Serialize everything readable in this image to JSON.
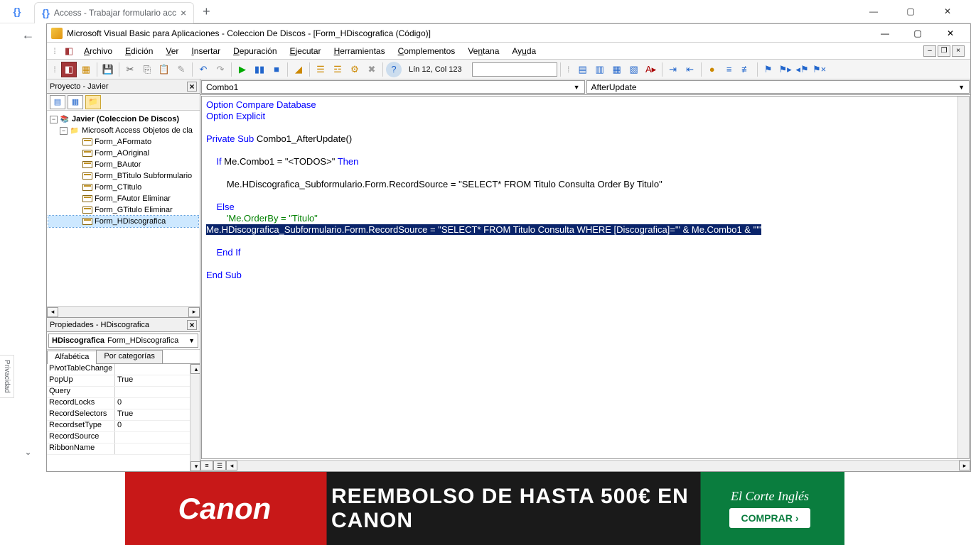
{
  "browser": {
    "tab_title": "Access - Trabajar formulario acc",
    "new_tab": "+"
  },
  "vba": {
    "title": "Microsoft Visual Basic para Aplicaciones - Coleccion De Discos - [Form_HDiscografica (Código)]",
    "menu": {
      "archivo": "Archivo",
      "edicion": "Edición",
      "ver": "Ver",
      "insertar": "Insertar",
      "depuracion": "Depuración",
      "ejecutar": "Ejecutar",
      "herramientas": "Herramientas",
      "complementos": "Complementos",
      "ventana": "Ventana",
      "ayuda": "Ayuda"
    },
    "toolbar_status": "Lín 12, Col 123"
  },
  "project": {
    "panel_title": "Proyecto - Javier",
    "root": "Javier (Coleccion De Discos)",
    "folder": "Microsoft Access Objetos de cla",
    "forms": [
      "Form_AFormato",
      "Form_AOriginal",
      "Form_BAutor",
      "Form_BTitulo Subformulario",
      "Form_CTitulo",
      "Form_FAutor Eliminar",
      "Form_GTitulo Eliminar",
      "Form_HDiscografica"
    ],
    "selected_index": 7
  },
  "properties": {
    "panel_title": "Propiedades - HDiscografica",
    "combo_bold": "HDiscografica",
    "combo_rest": "Form_HDiscografica",
    "tab_alpha": "Alfabética",
    "tab_cat": "Por categorías",
    "rows": [
      {
        "name": "PivotTableChange",
        "value": ""
      },
      {
        "name": "PopUp",
        "value": "True"
      },
      {
        "name": "Query",
        "value": ""
      },
      {
        "name": "RecordLocks",
        "value": "0"
      },
      {
        "name": "RecordSelectors",
        "value": "True"
      },
      {
        "name": "RecordsetType",
        "value": "0"
      },
      {
        "name": "RecordSource",
        "value": ""
      },
      {
        "name": "RibbonName",
        "value": ""
      }
    ]
  },
  "code": {
    "dd_object": "Combo1",
    "dd_proc": "AfterUpdate",
    "line1_a": "Option Compare Database",
    "line2_a": "Option Explicit",
    "line4_a": "Private Sub",
    "line4_b": " Combo1_AfterUpdate()",
    "line6_a": "    If",
    "line6_b": " Me.Combo1 = \"<TODOS>\" ",
    "line6_c": "Then",
    "line8": "        Me.HDiscografica_Subformulario.Form.RecordSource = \"SELECT* FROM Titulo Consulta Order By Titulo\"",
    "line10": "    Else",
    "line11": "        'Me.OrderBy = \"Titulo\"",
    "line12": "Me.HDiscografica_Subformulario.Form.RecordSource = \"SELECT* FROM Titulo Consulta WHERE [Discografica]='\" & Me.Combo1 & \"'\"",
    "line14_a": "    End If",
    "line16": "End Sub"
  },
  "ad": {
    "logo": "Canon",
    "text": "REEMBOLSO DE HASTA 500€ EN CANON",
    "store": "El Corte Inglés",
    "cta": "COMPRAR"
  },
  "privacy": "Privacidad"
}
